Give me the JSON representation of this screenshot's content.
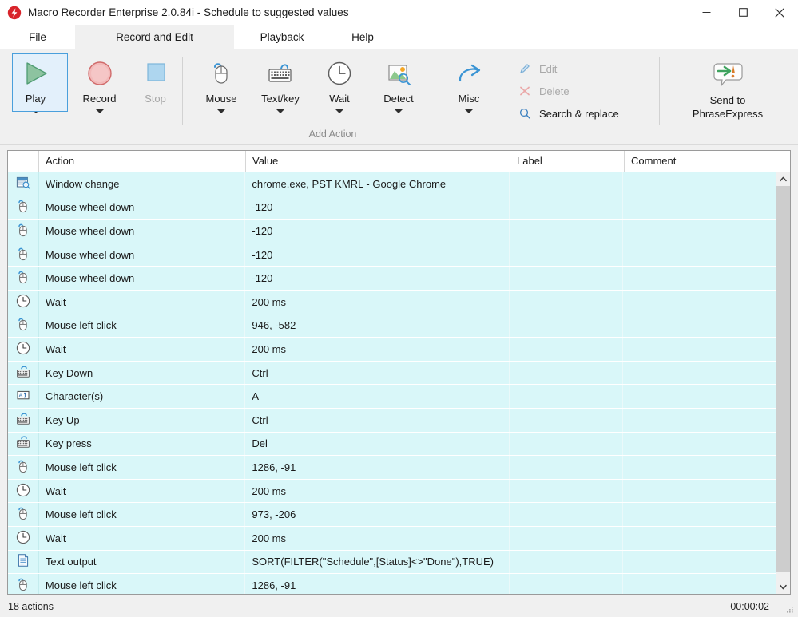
{
  "window": {
    "title": "Macro Recorder Enterprise 2.0.84i - Schedule to suggested values",
    "app_icon": "macro-recorder-icon",
    "minimize_label": "Minimize",
    "maximize_label": "Maximize",
    "close_label": "Close"
  },
  "tabs": [
    {
      "label": "File",
      "active": false
    },
    {
      "label": "Record and Edit",
      "active": true
    },
    {
      "label": "Playback",
      "active": false
    },
    {
      "label": "Help",
      "active": false
    }
  ],
  "ribbon": {
    "transport": [
      {
        "label": "Play",
        "icon": "play-triangle-icon",
        "selected": true,
        "enabled": true,
        "has_caret": true
      },
      {
        "label": "Record",
        "icon": "record-circle-icon",
        "selected": false,
        "enabled": true,
        "has_caret": true
      },
      {
        "label": "Stop",
        "icon": "stop-square-icon",
        "selected": false,
        "enabled": false,
        "has_caret": false
      }
    ],
    "add_action": {
      "group_label": "Add Action",
      "items": [
        {
          "label": "Mouse",
          "icon": "mouse-icon",
          "has_caret": true
        },
        {
          "label": "Text/key",
          "icon": "keyboard-icon",
          "has_caret": true
        },
        {
          "label": "Wait",
          "icon": "clock-icon",
          "has_caret": true
        },
        {
          "label": "Detect",
          "icon": "image-detect-icon",
          "has_caret": true
        },
        {
          "label": "Misc",
          "icon": "arrow-curve-icon",
          "has_caret": true
        }
      ]
    },
    "edit_commands": [
      {
        "label": "Edit",
        "icon": "pencil-icon",
        "enabled": false
      },
      {
        "label": "Delete",
        "icon": "x-delete-icon",
        "enabled": false
      },
      {
        "label": "Search & replace",
        "icon": "magnifier-icon",
        "enabled": true
      }
    ],
    "send_to": {
      "line1": "Send to",
      "line2": "PhraseExpress",
      "icon": "phraseexpress-icon"
    }
  },
  "grid": {
    "columns": [
      "",
      "Action",
      "Value",
      "Label",
      "Comment"
    ],
    "rows": [
      {
        "icon": "window-change-icon",
        "action": "Window change",
        "value": "chrome.exe, PST KMRL - Google Chrome",
        "label": "",
        "comment": ""
      },
      {
        "icon": "mouse-icon",
        "action": "Mouse wheel down",
        "value": "-120",
        "label": "",
        "comment": ""
      },
      {
        "icon": "mouse-icon",
        "action": "Mouse wheel down",
        "value": "-120",
        "label": "",
        "comment": ""
      },
      {
        "icon": "mouse-icon",
        "action": "Mouse wheel down",
        "value": "-120",
        "label": "",
        "comment": ""
      },
      {
        "icon": "mouse-icon",
        "action": "Mouse wheel down",
        "value": "-120",
        "label": "",
        "comment": ""
      },
      {
        "icon": "clock-icon",
        "action": "Wait",
        "value": "200 ms",
        "label": "",
        "comment": ""
      },
      {
        "icon": "mouse-icon",
        "action": "Mouse left click",
        "value": "946, -582",
        "label": "",
        "comment": ""
      },
      {
        "icon": "clock-icon",
        "action": "Wait",
        "value": "200 ms",
        "label": "",
        "comment": ""
      },
      {
        "icon": "keyboard-icon",
        "action": "Key Down",
        "value": "Ctrl",
        "label": "",
        "comment": ""
      },
      {
        "icon": "character-icon",
        "action": "Character(s)",
        "value": "A",
        "label": "",
        "comment": ""
      },
      {
        "icon": "keyboard-icon",
        "action": "Key Up",
        "value": "Ctrl",
        "label": "",
        "comment": ""
      },
      {
        "icon": "keyboard-icon",
        "action": "Key press",
        "value": "Del",
        "label": "",
        "comment": ""
      },
      {
        "icon": "mouse-icon",
        "action": "Mouse left click",
        "value": "1286, -91",
        "label": "",
        "comment": ""
      },
      {
        "icon": "clock-icon",
        "action": "Wait",
        "value": "200 ms",
        "label": "",
        "comment": ""
      },
      {
        "icon": "mouse-icon",
        "action": "Mouse left click",
        "value": "973, -206",
        "label": "",
        "comment": ""
      },
      {
        "icon": "clock-icon",
        "action": "Wait",
        "value": "200 ms",
        "label": "",
        "comment": ""
      },
      {
        "icon": "text-output-icon",
        "action": "Text output",
        "value": "SORT(FILTER(\"Schedule\",[Status]<>\"Done\"),TRUE)",
        "label": "",
        "comment": ""
      },
      {
        "icon": "mouse-icon",
        "action": "Mouse left click",
        "value": "1286, -91",
        "label": "",
        "comment": ""
      }
    ]
  },
  "scrollbar": {
    "up_arrow": "scroll-up-icon",
    "down_arrow": "scroll-down-icon"
  },
  "statusbar": {
    "count": "18 actions",
    "time": "00:00:02",
    "grip": "resize-grip-icon"
  },
  "colors": {
    "row_background": "#d9f7f9",
    "selection_border": "#4a9fdc",
    "selection_fill": "#e3f0fb",
    "accent_blue": "#2e86c8",
    "record_red": "#e08a8a",
    "play_green": "#8dc3a0",
    "window_chrome": "#f0f0f0"
  }
}
